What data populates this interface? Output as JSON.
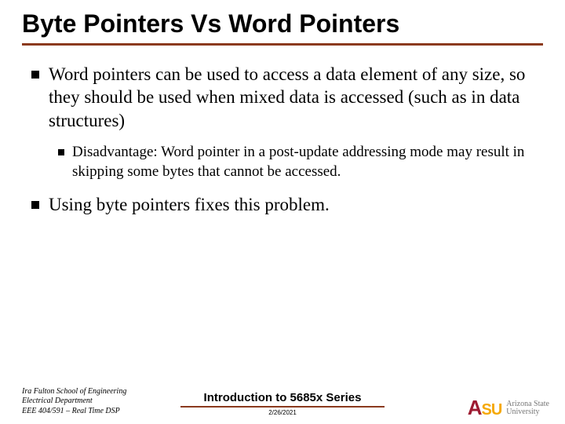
{
  "title": "Byte Pointers Vs Word Pointers",
  "bullets": {
    "b1": "Word pointers can be used to access a data element of any size, so they should be used when mixed data is accessed (such as in data structures)",
    "b2": "Disadvantage: Word pointer in a post-update addressing mode  may result in skipping some bytes that cannot be accessed.",
    "b3": "Using byte pointers fixes this problem."
  },
  "footer": {
    "left1": "Ira Fulton School of Engineering",
    "left2": "Electrical Department",
    "left3": "EEE 404/591 – Real Time DSP",
    "course": "Introduction to 5685x Series",
    "date": "2/26/2021",
    "logo_a": "A",
    "logo_su": "SU",
    "uni1": "Arizona State",
    "uni2": "University"
  }
}
